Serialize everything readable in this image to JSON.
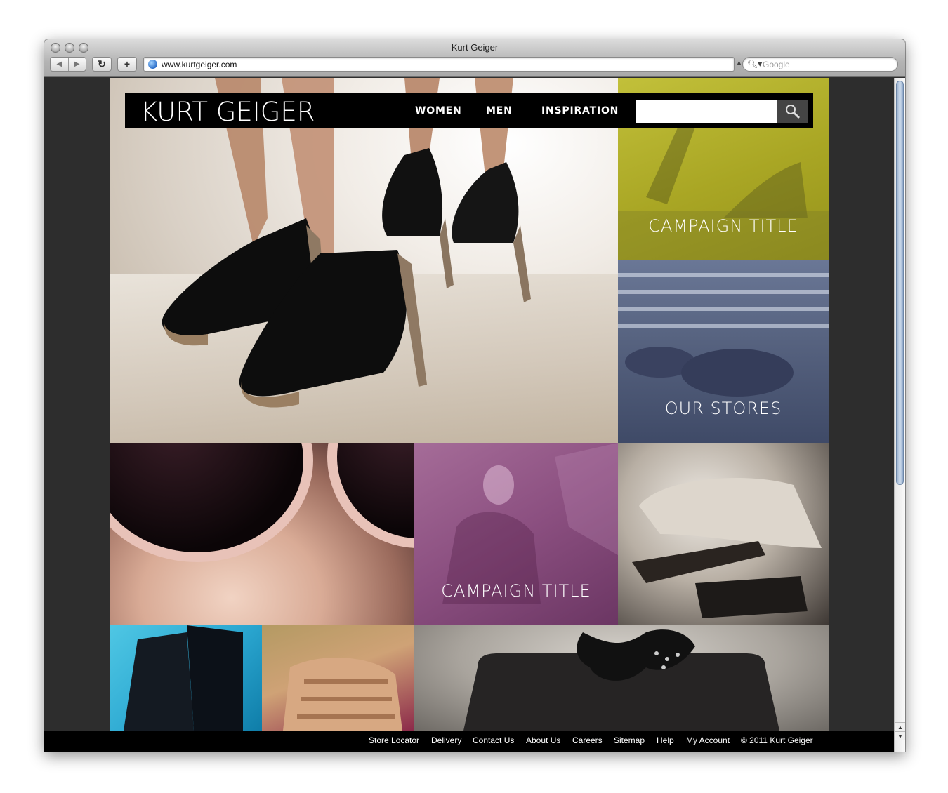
{
  "browser": {
    "window_title": "Kurt Geiger",
    "url": "www.kurtgeiger.com",
    "search_placeholder": "Google",
    "back_icon": "back-arrow-icon",
    "forward_icon": "forward-arrow-icon",
    "reload_icon": "reload-icon",
    "add_icon": "plus-icon"
  },
  "site": {
    "logo": "KURT GEIGER",
    "nav": [
      "WOMEN",
      "MEN",
      "INSPIRATION"
    ],
    "search_placeholder": "",
    "tiles": {
      "campaign_yellow": "CAMPAIGN TITLE",
      "stores": "OUR STORES",
      "campaign_purple": "CAMPAIGN TITLE"
    },
    "colors": {
      "yellow_tile": "#a9a624",
      "blue_tile": "#56627f",
      "purple_tile": "#8b4f80",
      "header": "#000000"
    }
  },
  "footer": {
    "links": [
      "Store Locator",
      "Delivery",
      "Contact Us",
      "About Us",
      "Careers",
      "Sitemap",
      "Help",
      "My Account"
    ],
    "copyright": "© 2011 Kurt Geiger"
  }
}
